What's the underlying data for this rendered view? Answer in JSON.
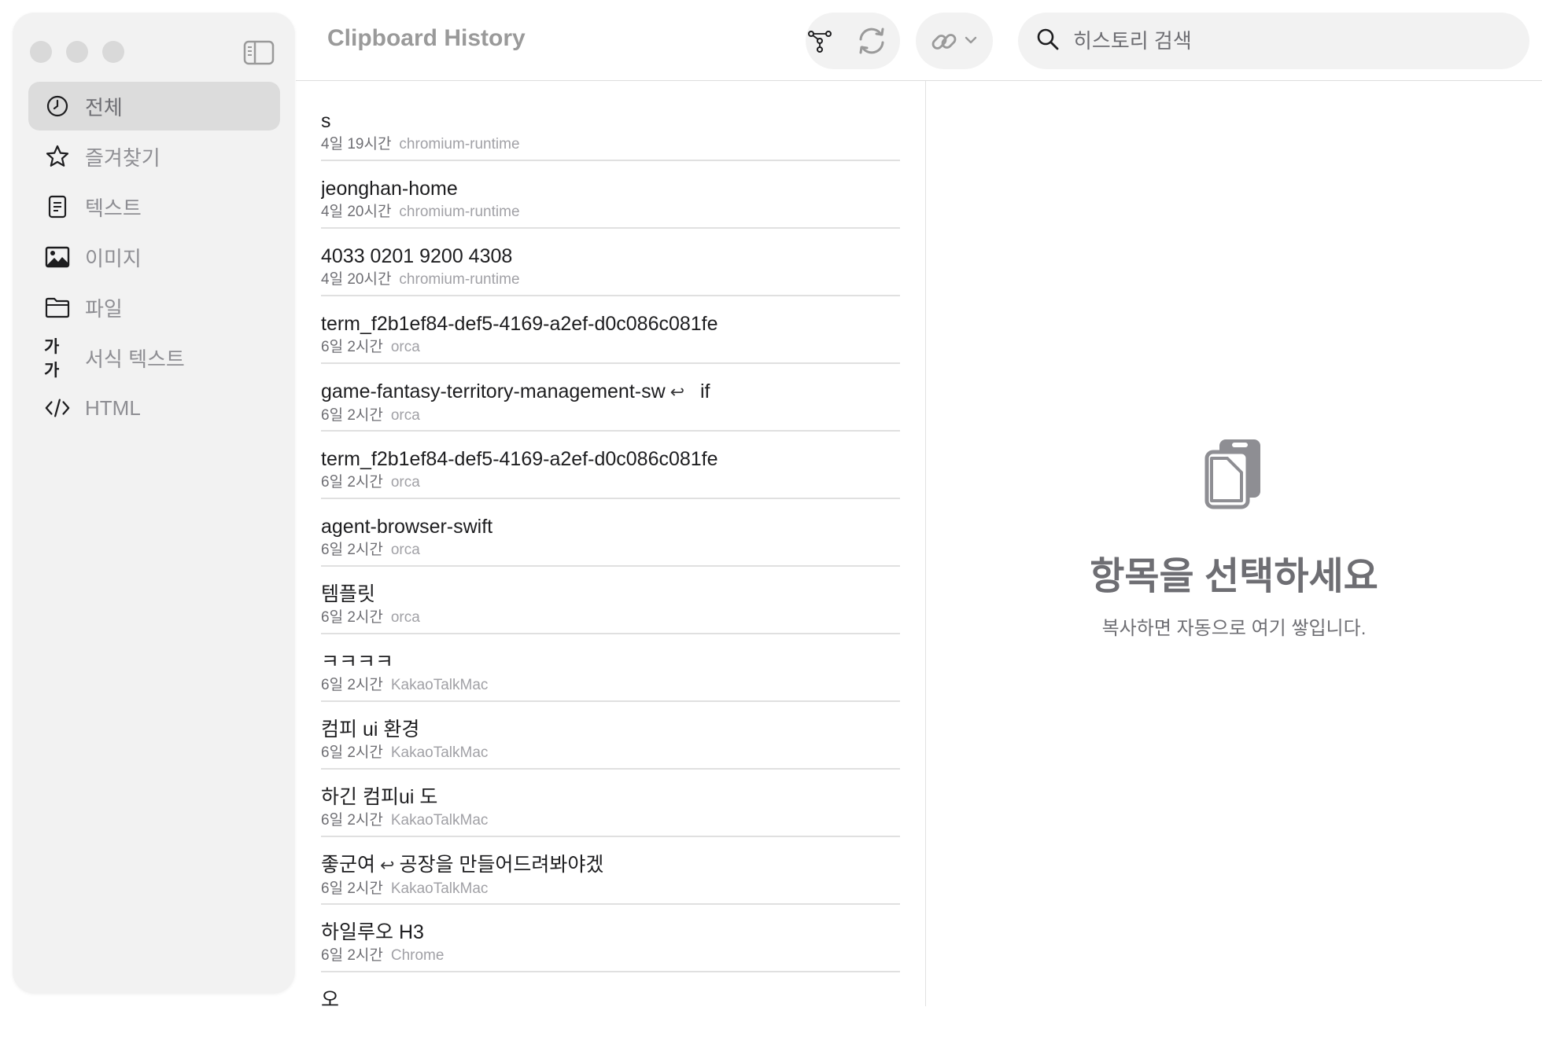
{
  "window": {
    "title": "Clipboard History"
  },
  "sidebar": {
    "items": [
      {
        "label": "전체",
        "icon": "clock-icon",
        "selected": true
      },
      {
        "label": "즐겨찾기",
        "icon": "star-icon",
        "selected": false
      },
      {
        "label": "텍스트",
        "icon": "document-icon",
        "selected": false
      },
      {
        "label": "이미지",
        "icon": "photo-icon",
        "selected": false
      },
      {
        "label": "파일",
        "icon": "folder-icon",
        "selected": false
      },
      {
        "label": "서식 텍스트",
        "icon": "rich-text-icon",
        "icon_text": "가가",
        "selected": false
      },
      {
        "label": "HTML",
        "icon": "code-icon",
        "selected": false
      }
    ]
  },
  "toolbar": {
    "buttons": [
      "filter-icon",
      "sync-icon",
      "link-icon",
      "chevron-down-icon"
    ],
    "search_placeholder": "히스토리 검색"
  },
  "list": {
    "return_glyph": "↩",
    "items": [
      {
        "title": "s",
        "time": "4일 19시간",
        "app": "chromium-runtime"
      },
      {
        "title": "jeonghan-home",
        "time": "4일 20시간",
        "app": "chromium-runtime"
      },
      {
        "title": "4033 0201 9200 4308",
        "time": "4일 20시간",
        "app": "chromium-runtime"
      },
      {
        "title": "term_f2b1ef84-def5-4169-a2ef-d0c086c081fe",
        "time": "6일 2시간",
        "app": "orca"
      },
      {
        "title_parts": [
          "game-fantasy-territory-management-sw",
          "if"
        ],
        "time": "6일 2시간",
        "app": "orca"
      },
      {
        "title": "term_f2b1ef84-def5-4169-a2ef-d0c086c081fe",
        "time": "6일 2시간",
        "app": "orca"
      },
      {
        "title": "agent-browser-swift",
        "time": "6일 2시간",
        "app": "orca"
      },
      {
        "title": "템플릿",
        "time": "6일 2시간",
        "app": "orca"
      },
      {
        "title": "ㅋㅋㅋㅋ",
        "time": "6일 2시간",
        "app": "KakaoTalkMac"
      },
      {
        "title": "컴피 ui 환경",
        "time": "6일 2시간",
        "app": "KakaoTalkMac"
      },
      {
        "title": "하긴 컴피ui 도",
        "time": "6일 2시간",
        "app": "KakaoTalkMac"
      },
      {
        "title_parts": [
          "좋군여",
          "공장을 만들어드려봐야겠"
        ],
        "time": "6일 2시간",
        "app": "KakaoTalkMac"
      },
      {
        "title": "하일루오 H3",
        "time": "6일 2시간",
        "app": "Chrome"
      },
      {
        "title": "오",
        "time": "",
        "app": ""
      }
    ]
  },
  "detail": {
    "icon": "clipboard-icon",
    "title": "항목을 선택하세요",
    "subtitle": "복사하면 자동으로 여기 쌓입니다."
  }
}
